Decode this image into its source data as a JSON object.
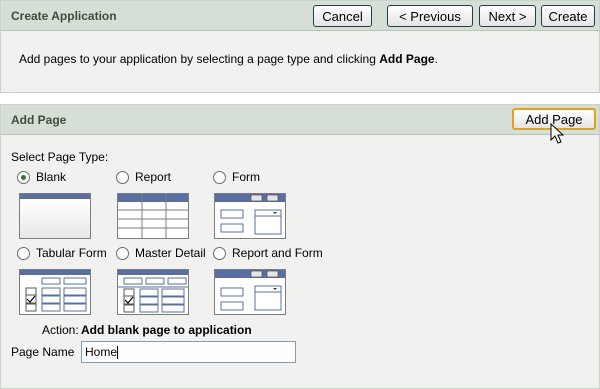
{
  "create": {
    "title": "Create Application",
    "buttons": {
      "cancel": "Cancel",
      "previous": "< Previous",
      "next": "Next >",
      "create": "Create"
    },
    "info_text": "Add pages to your application by selecting a page type and clicking ",
    "info_bold": "Add Page",
    "info_end": "."
  },
  "add_page": {
    "title": "Add Page",
    "button": "Add Page",
    "select_label": "Select Page Type:",
    "types": [
      {
        "label": "Blank",
        "checked": true
      },
      {
        "label": "Report",
        "checked": false
      },
      {
        "label": "Form",
        "checked": false
      },
      {
        "label": "Tabular Form",
        "checked": false
      },
      {
        "label": "Master Detail",
        "checked": false
      },
      {
        "label": "Report and Form",
        "checked": false
      }
    ],
    "action_label": "Action:",
    "action_value": "Add blank page to application",
    "page_name_label": "Page Name",
    "page_name_value": "Home"
  },
  "colors": {
    "header_bg": "#d5dfd5",
    "title_text": "#3d4d3d",
    "thumb_bar": "#5a6fa1",
    "focus_border": "#e1a01f"
  },
  "icons": {
    "cursor": "arrow-pointer-icon"
  }
}
